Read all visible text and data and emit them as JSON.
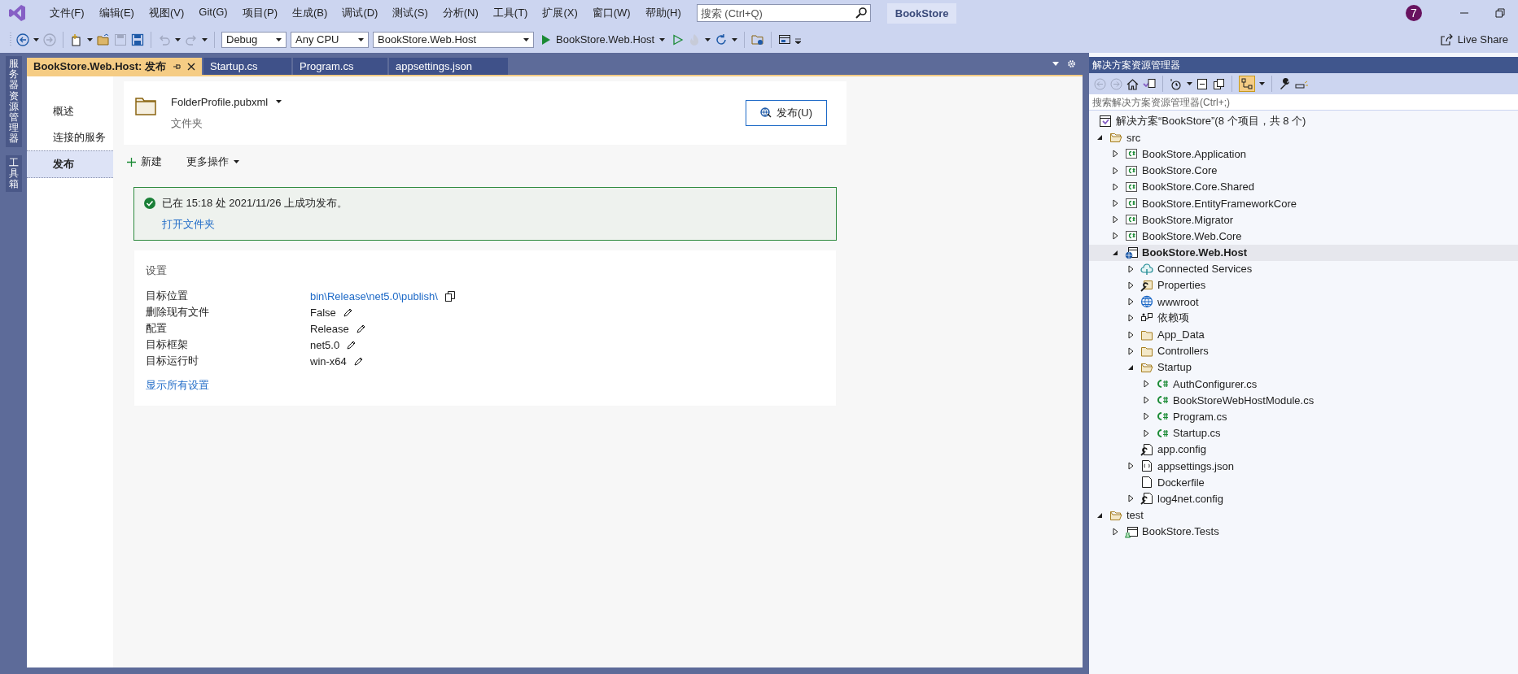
{
  "menu_bar": {
    "items": [
      "文件(F)",
      "编辑(E)",
      "视图(V)",
      "Git(G)",
      "项目(P)",
      "生成(B)",
      "调试(D)",
      "测试(S)",
      "分析(N)",
      "工具(T)",
      "扩展(X)",
      "窗口(W)",
      "帮助(H)"
    ],
    "search": {
      "placeholder": "搜索 (Ctrl+Q)"
    },
    "solution_name": "BookStore",
    "account_badge": "7"
  },
  "toolbar": {
    "configuration": "Debug",
    "platform": "Any CPU",
    "startup_project": "BookStore.Web.Host",
    "run_button": "BookStore.Web.Host",
    "live_share": "Live Share"
  },
  "side_strip": [
    "服务器资源管理器",
    "工具箱"
  ],
  "tabs": [
    {
      "label": "BookStore.Web.Host: 发布",
      "selected": true
    },
    {
      "label": "Startup.cs",
      "selected": false
    },
    {
      "label": "Program.cs",
      "selected": false
    },
    {
      "label": "appsettings.json",
      "selected": false
    }
  ],
  "publish": {
    "nav": [
      {
        "label": "概述",
        "selected": false
      },
      {
        "label": "连接的服务",
        "selected": false
      },
      {
        "label": "发布",
        "selected": true
      }
    ],
    "profile": {
      "name": "FolderProfile.pubxml",
      "type": "文件夹"
    },
    "publish_button": "发布(U)",
    "new_button": "新建",
    "more_menu": "更多操作",
    "status": {
      "kind": "success",
      "message": "已在 15:18 处 2021/11/26 上成功发布。",
      "link": "打开文件夹"
    },
    "settings": {
      "title": "设置",
      "rows": [
        {
          "label": "目标位置",
          "value": "bin\\Release\\net5.0\\publish\\",
          "kind": "link"
        },
        {
          "label": "删除现有文件",
          "value": "False",
          "kind": "editable"
        },
        {
          "label": "配置",
          "value": "Release",
          "kind": "editable"
        },
        {
          "label": "目标框架",
          "value": "net5.0",
          "kind": "editable"
        },
        {
          "label": "目标运行时",
          "value": "win-x64",
          "kind": "editable"
        }
      ],
      "link": "显示所有设置"
    }
  },
  "solution_explorer": {
    "title": "解决方案资源管理器",
    "search": {
      "placeholder": "搜索解决方案资源管理器(Ctrl+;)"
    },
    "solution": "解决方案“BookStore”(8 个项目，共 8 个)",
    "tree": [
      {
        "label": "src",
        "kind": "folder-open",
        "expanded": true,
        "selected": false,
        "children": [
          {
            "label": "BookStore.Application",
            "kind": "csproj",
            "expanded": false,
            "selected": false
          },
          {
            "label": "BookStore.Core",
            "kind": "csproj",
            "expanded": false,
            "selected": false
          },
          {
            "label": "BookStore.Core.Shared",
            "kind": "csproj",
            "expanded": false,
            "selected": false
          },
          {
            "label": "BookStore.EntityFrameworkCore",
            "kind": "csproj",
            "expanded": false,
            "selected": false
          },
          {
            "label": "BookStore.Migrator",
            "kind": "csproj",
            "expanded": false,
            "selected": false
          },
          {
            "label": "BookStore.Web.Core",
            "kind": "csproj",
            "expanded": false,
            "selected": false
          },
          {
            "label": "BookStore.Web.Host",
            "kind": "webproj",
            "expanded": true,
            "selected": true,
            "children": [
              {
                "label": "Connected Services",
                "kind": "cloud",
                "expanded": false,
                "selected": false
              },
              {
                "label": "Properties",
                "kind": "properties",
                "expanded": false,
                "selected": false
              },
              {
                "label": "wwwroot",
                "kind": "globe",
                "expanded": false,
                "selected": false
              },
              {
                "label": "依赖项",
                "kind": "deps",
                "expanded": false,
                "selected": false
              },
              {
                "label": "App_Data",
                "kind": "folder",
                "expanded": false,
                "selected": false
              },
              {
                "label": "Controllers",
                "kind": "folder",
                "expanded": false,
                "selected": false
              },
              {
                "label": "Startup",
                "kind": "folder-open",
                "expanded": true,
                "selected": false,
                "children": [
                  {
                    "label": "AuthConfigurer.cs",
                    "kind": "csfile",
                    "expanded": false,
                    "selected": false
                  },
                  {
                    "label": "BookStoreWebHostModule.cs",
                    "kind": "csfile",
                    "expanded": false,
                    "selected": false
                  },
                  {
                    "label": "Program.cs",
                    "kind": "csfile",
                    "expanded": false,
                    "selected": false
                  },
                  {
                    "label": "Startup.cs",
                    "kind": "csfile",
                    "expanded": false,
                    "selected": false
                  }
                ]
              },
              {
                "label": "app.config",
                "kind": "config",
                "selected": false
              },
              {
                "label": "appsettings.json",
                "kind": "json",
                "expanded": false,
                "selected": false
              },
              {
                "label": "Dockerfile",
                "kind": "file",
                "selected": false
              },
              {
                "label": "log4net.config",
                "kind": "config",
                "expanded": false,
                "selected": false
              }
            ]
          }
        ]
      },
      {
        "label": "test",
        "kind": "folder-open",
        "expanded": true,
        "selected": false,
        "children": [
          {
            "label": "BookStore.Tests",
            "kind": "testproj",
            "expanded": false,
            "selected": false
          }
        ]
      }
    ]
  }
}
